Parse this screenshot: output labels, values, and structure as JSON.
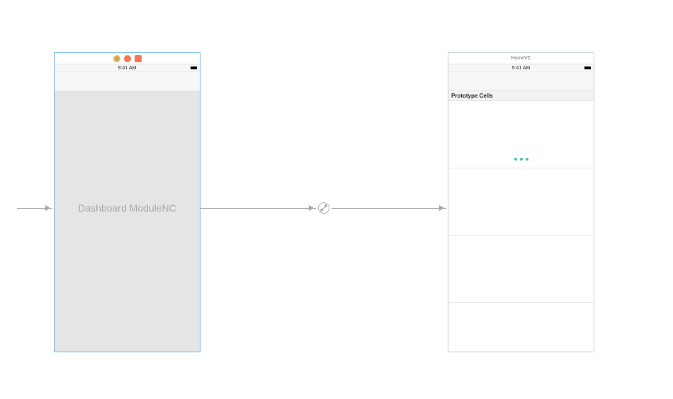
{
  "dashboard": {
    "placeholder": "Dashboard ModuleNC",
    "statusbar_time": "9:41 AM"
  },
  "home": {
    "title": "HomeVC",
    "statusbar_time": "9:41 AM",
    "table_header": "Prototype Cells"
  }
}
